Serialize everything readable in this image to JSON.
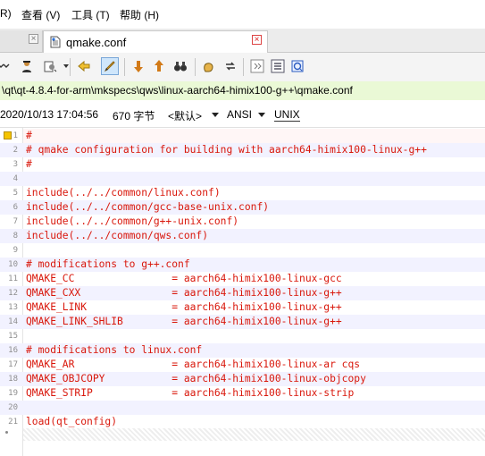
{
  "menu": {
    "items": [
      {
        "label": "R)"
      },
      {
        "label": "查看 (V)"
      },
      {
        "label": "工具 (T)"
      },
      {
        "label": "帮助 (H)"
      }
    ]
  },
  "tabs": [
    {
      "label": "",
      "active": false
    },
    {
      "label": "qmake.conf",
      "active": true
    }
  ],
  "toolbar": {
    "buttons": [
      "word-wrap-icon",
      "user-icon",
      "settings-icon",
      "prev-icon",
      "pen-icon",
      "down-arrow-icon",
      "up-arrow-icon",
      "binoculars-icon",
      "hand-icon",
      "swap-icon",
      "expand-icon",
      "list-icon",
      "clipboard-icon"
    ]
  },
  "path": "\\qt\\qt-4.8.4-for-arm\\mkspecs\\qws\\linux-aarch64-himix100-g++\\qmake.conf",
  "info": {
    "datetime": "2020/10/13 17:04:56",
    "size": "670 字节",
    "encoding_default": "<默认>",
    "charset": "ANSI",
    "line_ending": "UNIX"
  },
  "colors": {
    "code_text": "#d9170b",
    "path_bg": "#eaf9d6",
    "even_line_bg": "#f2f2ff"
  },
  "editor": {
    "lines": [
      {
        "n": "1",
        "text": "#"
      },
      {
        "n": "2",
        "text": "# qmake configuration for building with aarch64-himix100-linux-g++"
      },
      {
        "n": "3",
        "text": "#"
      },
      {
        "n": "4",
        "text": ""
      },
      {
        "n": "5",
        "text": "include(../../common/linux.conf)"
      },
      {
        "n": "6",
        "text": "include(../../common/gcc-base-unix.conf)"
      },
      {
        "n": "7",
        "text": "include(../../common/g++-unix.conf)"
      },
      {
        "n": "8",
        "text": "include(../../common/qws.conf)"
      },
      {
        "n": "9",
        "text": ""
      },
      {
        "n": "10",
        "text": "# modifications to g++.conf"
      },
      {
        "n": "11",
        "text": "QMAKE_CC                = aarch64-himix100-linux-gcc"
      },
      {
        "n": "12",
        "text": "QMAKE_CXX               = aarch64-himix100-linux-g++"
      },
      {
        "n": "13",
        "text": "QMAKE_LINK              = aarch64-himix100-linux-g++"
      },
      {
        "n": "14",
        "text": "QMAKE_LINK_SHLIB        = aarch64-himix100-linux-g++"
      },
      {
        "n": "15",
        "text": ""
      },
      {
        "n": "16",
        "text": "# modifications to linux.conf"
      },
      {
        "n": "17",
        "text": "QMAKE_AR                = aarch64-himix100-linux-ar cqs"
      },
      {
        "n": "18",
        "text": "QMAKE_OBJCOPY           = aarch64-himix100-linux-objcopy"
      },
      {
        "n": "19",
        "text": "QMAKE_STRIP             = aarch64-himix100-linux-strip"
      },
      {
        "n": "20",
        "text": ""
      },
      {
        "n": "21",
        "text": "load(qt_config)"
      }
    ]
  }
}
